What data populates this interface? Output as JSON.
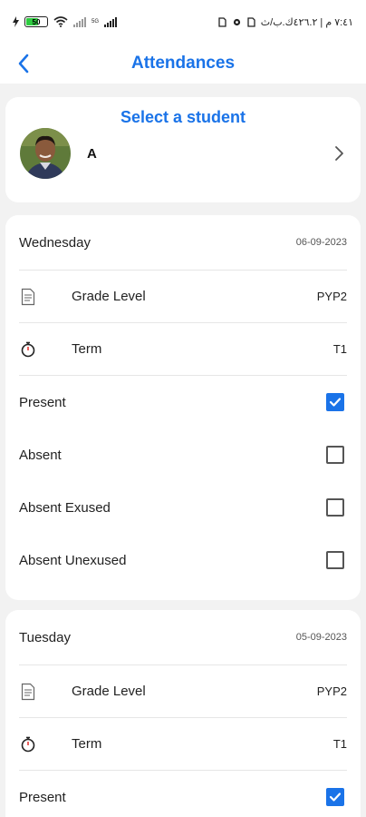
{
  "status_bar": {
    "battery": "50",
    "time_text": "٧:٤١ م | ٤٢٦.٢ك.ب/ث",
    "net_speed": "5G"
  },
  "app_bar": {
    "title": "Attendances"
  },
  "student_select": {
    "title": "Select a student",
    "student_name": "A"
  },
  "attendance": [
    {
      "day": "Wednesday",
      "date": "06-09-2023",
      "grade_label": "Grade Level",
      "grade_value": "PYP2",
      "term_label": "Term",
      "term_value": "T1",
      "options": [
        {
          "label": "Present",
          "checked": true
        },
        {
          "label": "Absent",
          "checked": false
        },
        {
          "label": "Absent Exused",
          "checked": false
        },
        {
          "label": "Absent Unexused",
          "checked": false
        }
      ]
    },
    {
      "day": "Tuesday",
      "date": "05-09-2023",
      "grade_label": "Grade Level",
      "grade_value": "PYP2",
      "term_label": "Term",
      "term_value": "T1",
      "options": [
        {
          "label": "Present",
          "checked": true
        }
      ]
    }
  ],
  "colors": {
    "accent": "#1a73e8",
    "background": "#f2f2f2",
    "card": "#ffffff"
  }
}
